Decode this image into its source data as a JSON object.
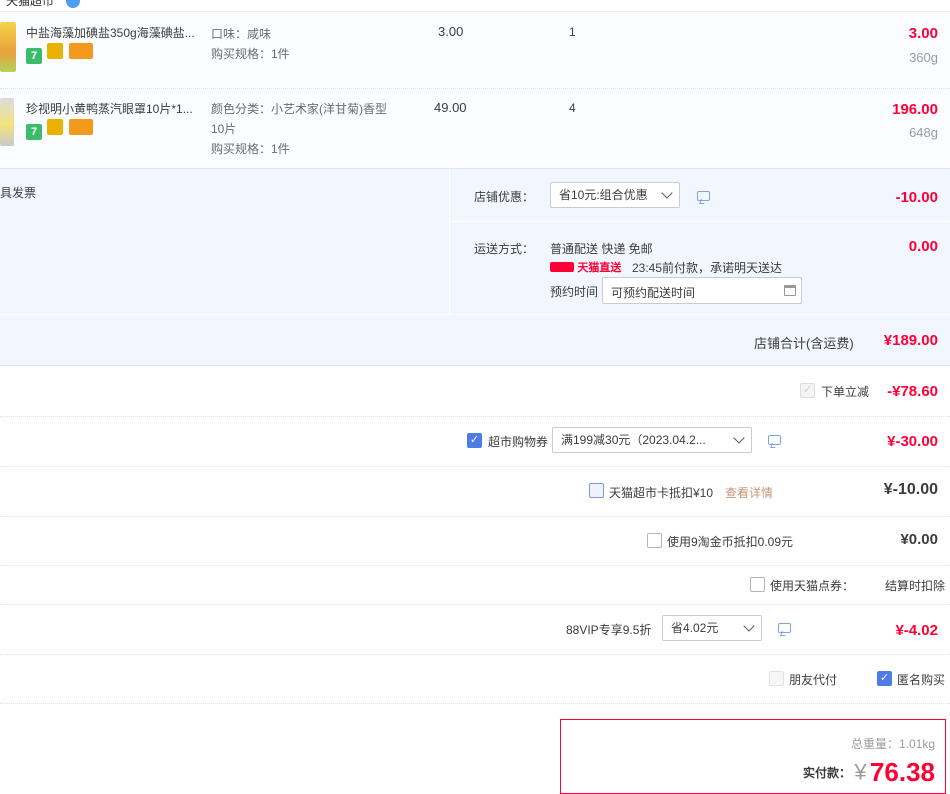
{
  "top_label": "天猫超市",
  "items": [
    {
      "title": "中盐海藻加碘盐350g海藻碘盐...",
      "attr1": "口味：咸味",
      "attr2": "购买规格：1件",
      "price": "3.00",
      "qty": "1",
      "subtotal": "3.00",
      "weight": "360g"
    },
    {
      "title": "珍视明小黄鸭蒸汽眼罩10片*1...",
      "attr1": "颜色分类：小艺术家(洋甘菊)香型",
      "attr1b": "10片",
      "attr2": "购买规格：1件",
      "price": "49.00",
      "qty": "4",
      "subtotal": "196.00",
      "weight": "648g"
    }
  ],
  "invoice": {
    "label": "具发票"
  },
  "shop_discount": {
    "label": "店铺优惠：",
    "selected": "省10元:组合优惠",
    "amount": "-10.00"
  },
  "shipping": {
    "label": "运送方式：",
    "method": "普通配送 快递 免邮",
    "badge": "天猫直送",
    "promise": "23:45前付款，承诺明天送达",
    "appt_label": "预约时间",
    "appt_placeholder": "可预约配送时间",
    "amount": "0.00"
  },
  "shop_total": {
    "label": "店铺合计(含运费)",
    "amount": "¥189.00"
  },
  "order_discount": {
    "label": "下单立减",
    "amount": "-¥78.60"
  },
  "coupon": {
    "label": "超市购物券",
    "selected": "满199减30元（2023.04.2...",
    "amount": "¥-30.00"
  },
  "tmall_card": {
    "label": "天猫超市卡抵扣¥10",
    "link": "查看详情",
    "amount": "¥-10.00"
  },
  "taojinbi": {
    "label": "使用9淘金币抵扣0.09元",
    "amount": "¥0.00"
  },
  "tmall_points": {
    "label": "使用天猫点券：",
    "note": "结算时扣除"
  },
  "vip": {
    "label": "88VIP专享9.5折",
    "selected": "省4.02元",
    "amount": "¥-4.02"
  },
  "payment_options": {
    "friend_pay": "朋友代付",
    "anonymous": "匿名购买"
  },
  "summary": {
    "weight_label": "总重量：",
    "weight_value": "1.01kg",
    "pay_label": "实付款：",
    "currency": "¥",
    "pay_amount": "76.38"
  },
  "colors": {
    "accent_red": "#ff0036",
    "accent_blue": "#4d7ce4",
    "panel_blue": "#f2f7ff"
  }
}
